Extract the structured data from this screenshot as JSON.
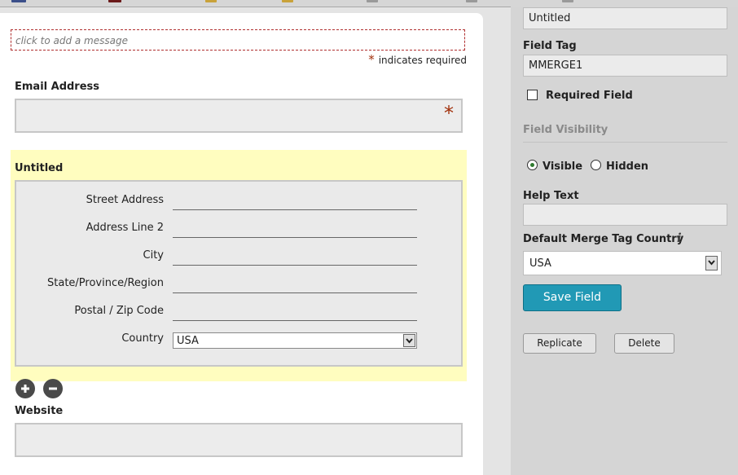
{
  "form": {
    "message_placeholder": "click to add a message",
    "required_star": "*",
    "required_note": "indicates required",
    "email_label": "Email Address",
    "email_required_star": "*",
    "address": {
      "title": "Untitled",
      "street_label": "Street Address",
      "line2_label": "Address Line 2",
      "city_label": "City",
      "state_label": "State/Province/Region",
      "zip_label": "Postal / Zip Code",
      "country_label": "Country",
      "country_value": "USA"
    },
    "website_label": "Website"
  },
  "settings": {
    "field_label_value": "Untitled",
    "field_tag_label": "Field Tag",
    "field_tag_value": "MMERGE1",
    "required_field_label": "Required Field",
    "visibility_heading": "Field Visibility",
    "visible_label": "Visible",
    "hidden_label": "Hidden",
    "visibility_selected": "Visible",
    "help_text_label": "Help Text",
    "help_text_value": "",
    "default_country_label": "Default Merge Tag Country",
    "default_country_value": "USA",
    "save_label": "Save Field",
    "replicate_label": "Replicate",
    "delete_label": "Delete"
  },
  "colors": {
    "required_star": "#a12f0a",
    "group_highlight": "#fffdbf",
    "save_button": "#2199b5"
  },
  "icons": {
    "add": "plus-circle-icon",
    "remove": "minus-circle-icon",
    "info": "info-icon",
    "dropdown": "chevron-down-icon"
  }
}
